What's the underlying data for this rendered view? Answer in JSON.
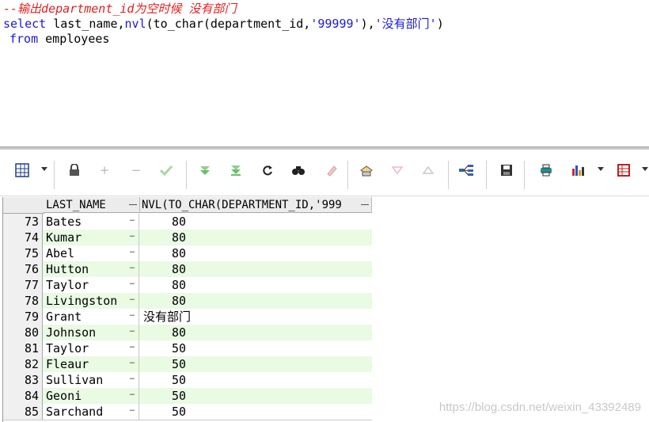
{
  "editor": {
    "comment": "--输出department_id为空时候 没有部门",
    "line2_kw": "select",
    "line2_cols": " last_name,",
    "line2_fn": "nvl",
    "line2_args1": "(to_char(department_id,",
    "line2_str1": "'99999'",
    "line2_args2": "),",
    "line2_str2": "'没有部门'",
    "line2_end": ")",
    "line3_kw": "from",
    "line3_table": " employees"
  },
  "toolbar": {
    "icons": [
      "grid-view-icon",
      "lock-icon",
      "add-record-icon",
      "delete-record-icon",
      "post-changes-icon",
      "fetch-next-icon",
      "fetch-last-icon",
      "refresh-icon",
      "find-icon",
      "clear-icon",
      "export-icon",
      "sort-desc-icon",
      "sort-asc-icon",
      "query-builder-icon",
      "save-icon",
      "print-icon",
      "chart-icon",
      "table-options-icon"
    ]
  },
  "grid": {
    "columns": [
      "LAST_NAME",
      "NVL(TO_CHAR(DEPARTMENT_ID,'999"
    ],
    "rows": [
      {
        "num": "73",
        "name": "Bates",
        "val": "80"
      },
      {
        "num": "74",
        "name": "Kumar",
        "val": "80"
      },
      {
        "num": "75",
        "name": "Abel",
        "val": "80"
      },
      {
        "num": "76",
        "name": "Hutton",
        "val": "80"
      },
      {
        "num": "77",
        "name": "Taylor",
        "val": "80"
      },
      {
        "num": "78",
        "name": "Livingston",
        "val": "80"
      },
      {
        "num": "79",
        "name": "Grant",
        "val": "没有部门"
      },
      {
        "num": "80",
        "name": "Johnson",
        "val": "80"
      },
      {
        "num": "81",
        "name": "Taylor",
        "val": "50"
      },
      {
        "num": "82",
        "name": "Fleaur",
        "val": "50"
      },
      {
        "num": "83",
        "name": "Sullivan",
        "val": "50"
      },
      {
        "num": "84",
        "name": "Geoni",
        "val": "50"
      },
      {
        "num": "85",
        "name": "Sarchand",
        "val": "50"
      }
    ],
    "cell_dots": "…"
  },
  "watermark": "https://blog.csdn.net/weixin_43392489",
  "colors": {
    "even_row": "#e9fbe3",
    "keyword": "#1a1ad8",
    "comment": "#e02020"
  }
}
